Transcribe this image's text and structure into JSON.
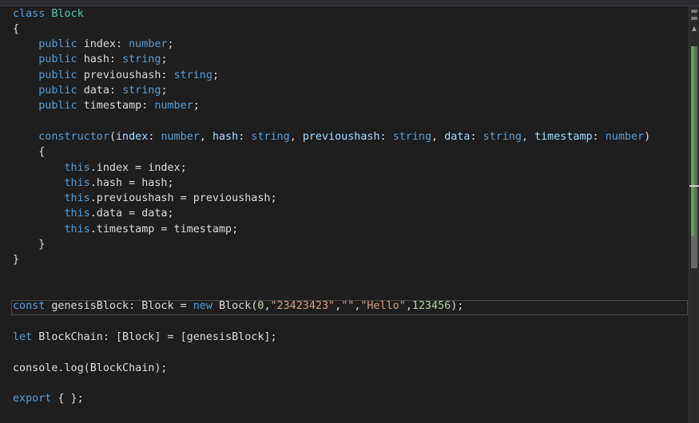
{
  "editor": {
    "lines": {
      "l1": {
        "kw": "class",
        "cls": "Block"
      },
      "l2": {
        "text": "{"
      },
      "l3": {
        "kw": "public",
        "name": "index:",
        "type": "number",
        "end": ";"
      },
      "l4": {
        "kw": "public",
        "name": "hash:",
        "type": "string",
        "end": ";"
      },
      "l5": {
        "kw": "public",
        "name": "previoushash:",
        "type": "string",
        "end": ";"
      },
      "l6": {
        "kw": "public",
        "name": "data:",
        "type": "string",
        "end": ";"
      },
      "l7": {
        "kw": "public",
        "name": "timestamp:",
        "type": "number",
        "end": ";"
      },
      "l9": {
        "kw": "constructor",
        "p1": "index",
        "t1": "number",
        "p2": "hash",
        "t2": "string",
        "p3": "previoushash",
        "t3": "string",
        "p4": "data",
        "t4": "string",
        "p5": "timestamp",
        "t5": "number",
        "open": "(",
        "close": ")",
        "colon": ": ",
        "comma": ", "
      },
      "l10": {
        "text": "{"
      },
      "l11": {
        "kw": "this",
        "rest": ".index = index;"
      },
      "l12": {
        "kw": "this",
        "rest": ".hash = hash;"
      },
      "l13": {
        "kw": "this",
        "rest": ".previoushash = previoushash;"
      },
      "l14": {
        "kw": "this",
        "rest": ".data = data;"
      },
      "l15": {
        "kw": "this",
        "rest": ".timestamp = timestamp;"
      },
      "l16": {
        "text": "}"
      },
      "l17": {
        "text": "}"
      },
      "l20": {
        "kw": "const",
        "mid": " genesisBlock: Block = ",
        "kw2": "new",
        "call": " Block(",
        "n1": "0",
        "s1": "\"23423423\"",
        "s2": "\"\"",
        "s3": "\"Hello\"",
        "n2": "123456",
        "end": ");",
        "comma": ","
      },
      "l22": {
        "kw": "let",
        "rest": " BlockChain: [Block] = [genesisBlock];"
      },
      "l24": {
        "text": "console.log(BlockChain);"
      },
      "l26": {
        "kw": "export",
        "rest": " { };"
      }
    }
  },
  "scrollbar": {
    "split_icon": "split-editor-icon",
    "up_icon": "scroll-up-arrow-icon"
  }
}
